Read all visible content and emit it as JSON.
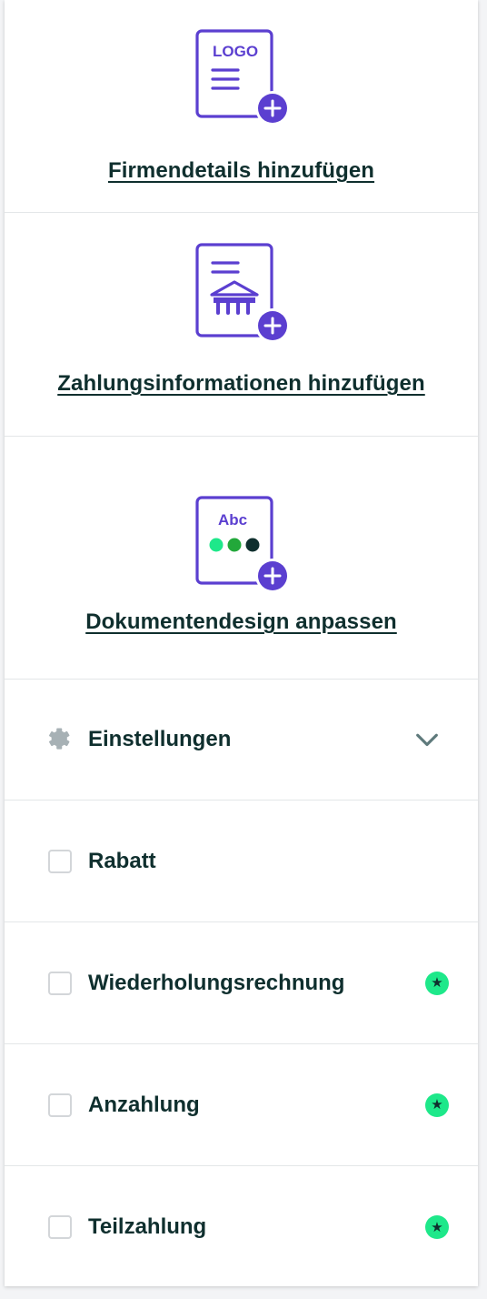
{
  "cards": [
    {
      "label": "Firmendetails hinzufügen",
      "icon": "logo-document-add-icon",
      "logo_text": "LOGO"
    },
    {
      "label": "Zahlungsinformationen hinzufügen",
      "icon": "bank-document-add-icon"
    },
    {
      "label": "Dokumentendesign anpassen",
      "icon": "design-document-add-icon",
      "abc_text": "Abc"
    }
  ],
  "settings": {
    "label": "Einstellungen",
    "icon": "gear-icon",
    "toggle_icon": "chevron-down-icon"
  },
  "options": [
    {
      "label": "Rabatt",
      "checked": false,
      "premium": false
    },
    {
      "label": "Wiederholungsrechnung",
      "checked": false,
      "premium": true
    },
    {
      "label": "Anzahlung",
      "checked": false,
      "premium": true
    },
    {
      "label": "Teilzahlung",
      "checked": false,
      "premium": true
    }
  ],
  "premium_badge": {
    "symbol": "★",
    "icon": "star-icon"
  },
  "colors": {
    "accent": "#5b3fd0",
    "text": "#0f2f2e",
    "premium": "#1ee88a",
    "dot_green_light": "#1ee88a",
    "dot_green_dark": "#22a83a",
    "dot_dark": "#0f2f2e",
    "border": "#e3e6e8"
  }
}
